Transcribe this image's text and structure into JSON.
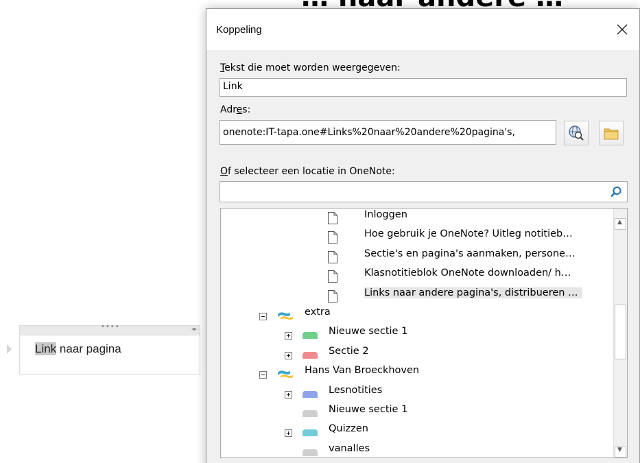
{
  "heading_partial": "… naar andere …",
  "note": {
    "highlighted_word": "Link",
    "rest_text": " naar pagina",
    "handle_dots": "••••",
    "resize_glyph": "◂▸"
  },
  "dialog": {
    "title": "Koppeling",
    "close_glyph": "✕",
    "display_text_label_first": "T",
    "display_text_label_rest": "ekst die moet worden weergegeven:",
    "display_text_value": "Link",
    "address_label_pre": "Adr",
    "address_label_u": "e",
    "address_label_post": "s:",
    "address_value": "onenote:IT-tapa.one#Links%20naar%20andere%20pagina's,",
    "browse_web_icon": "globe-search-icon",
    "browse_file_icon": "folder-icon",
    "location_label_first": "O",
    "location_label_rest": "f selecteer een locatie in OneNote:",
    "search_value": "",
    "search_icon": "magnifier-icon"
  },
  "tree": {
    "pages": [
      {
        "label": "Inloggen",
        "selected": false
      },
      {
        "label": "Hoe gebruik je OneNote? Uitleg notitieb…",
        "selected": false
      },
      {
        "label": "Sectie's en pagina's aanmaken, persone…",
        "selected": false
      },
      {
        "label": "Klasnotitieblok OneNote downloaden/ h…",
        "selected": false
      },
      {
        "label": "Links naar andere pagina's, distribueren …",
        "selected": true
      }
    ],
    "notebooks": [
      {
        "label": "extra",
        "expanded": true,
        "sections": [
          {
            "label": "Nieuwe sectie 1",
            "color": "#6fcf8a",
            "expander": "plus"
          },
          {
            "label": "Sectie 2",
            "color": "#f08a8f",
            "expander": "plus"
          }
        ]
      },
      {
        "label": "Hans Van Broeckhoven",
        "expanded": true,
        "sections": [
          {
            "label": "Lesnotities",
            "color": "#8ea4e8",
            "expander": "plus"
          },
          {
            "label": "Nieuwe sectie 1",
            "color": "#cfcfcf",
            "expander": "none"
          },
          {
            "label": "Quizzen",
            "color": "#74ccd8",
            "expander": "plus"
          },
          {
            "label": "vanalles",
            "color": "#cfcfcf",
            "expander": "none"
          }
        ]
      }
    ],
    "scroll_up_glyph": "▲",
    "scroll_down_glyph": "▼"
  },
  "colors": {
    "selected_row": "#e5e5e5",
    "dialog_bg": "#f0f0f0",
    "notebook_icon_teal": "#3aa8c8",
    "notebook_icon_yellow": "#f3c13a"
  }
}
